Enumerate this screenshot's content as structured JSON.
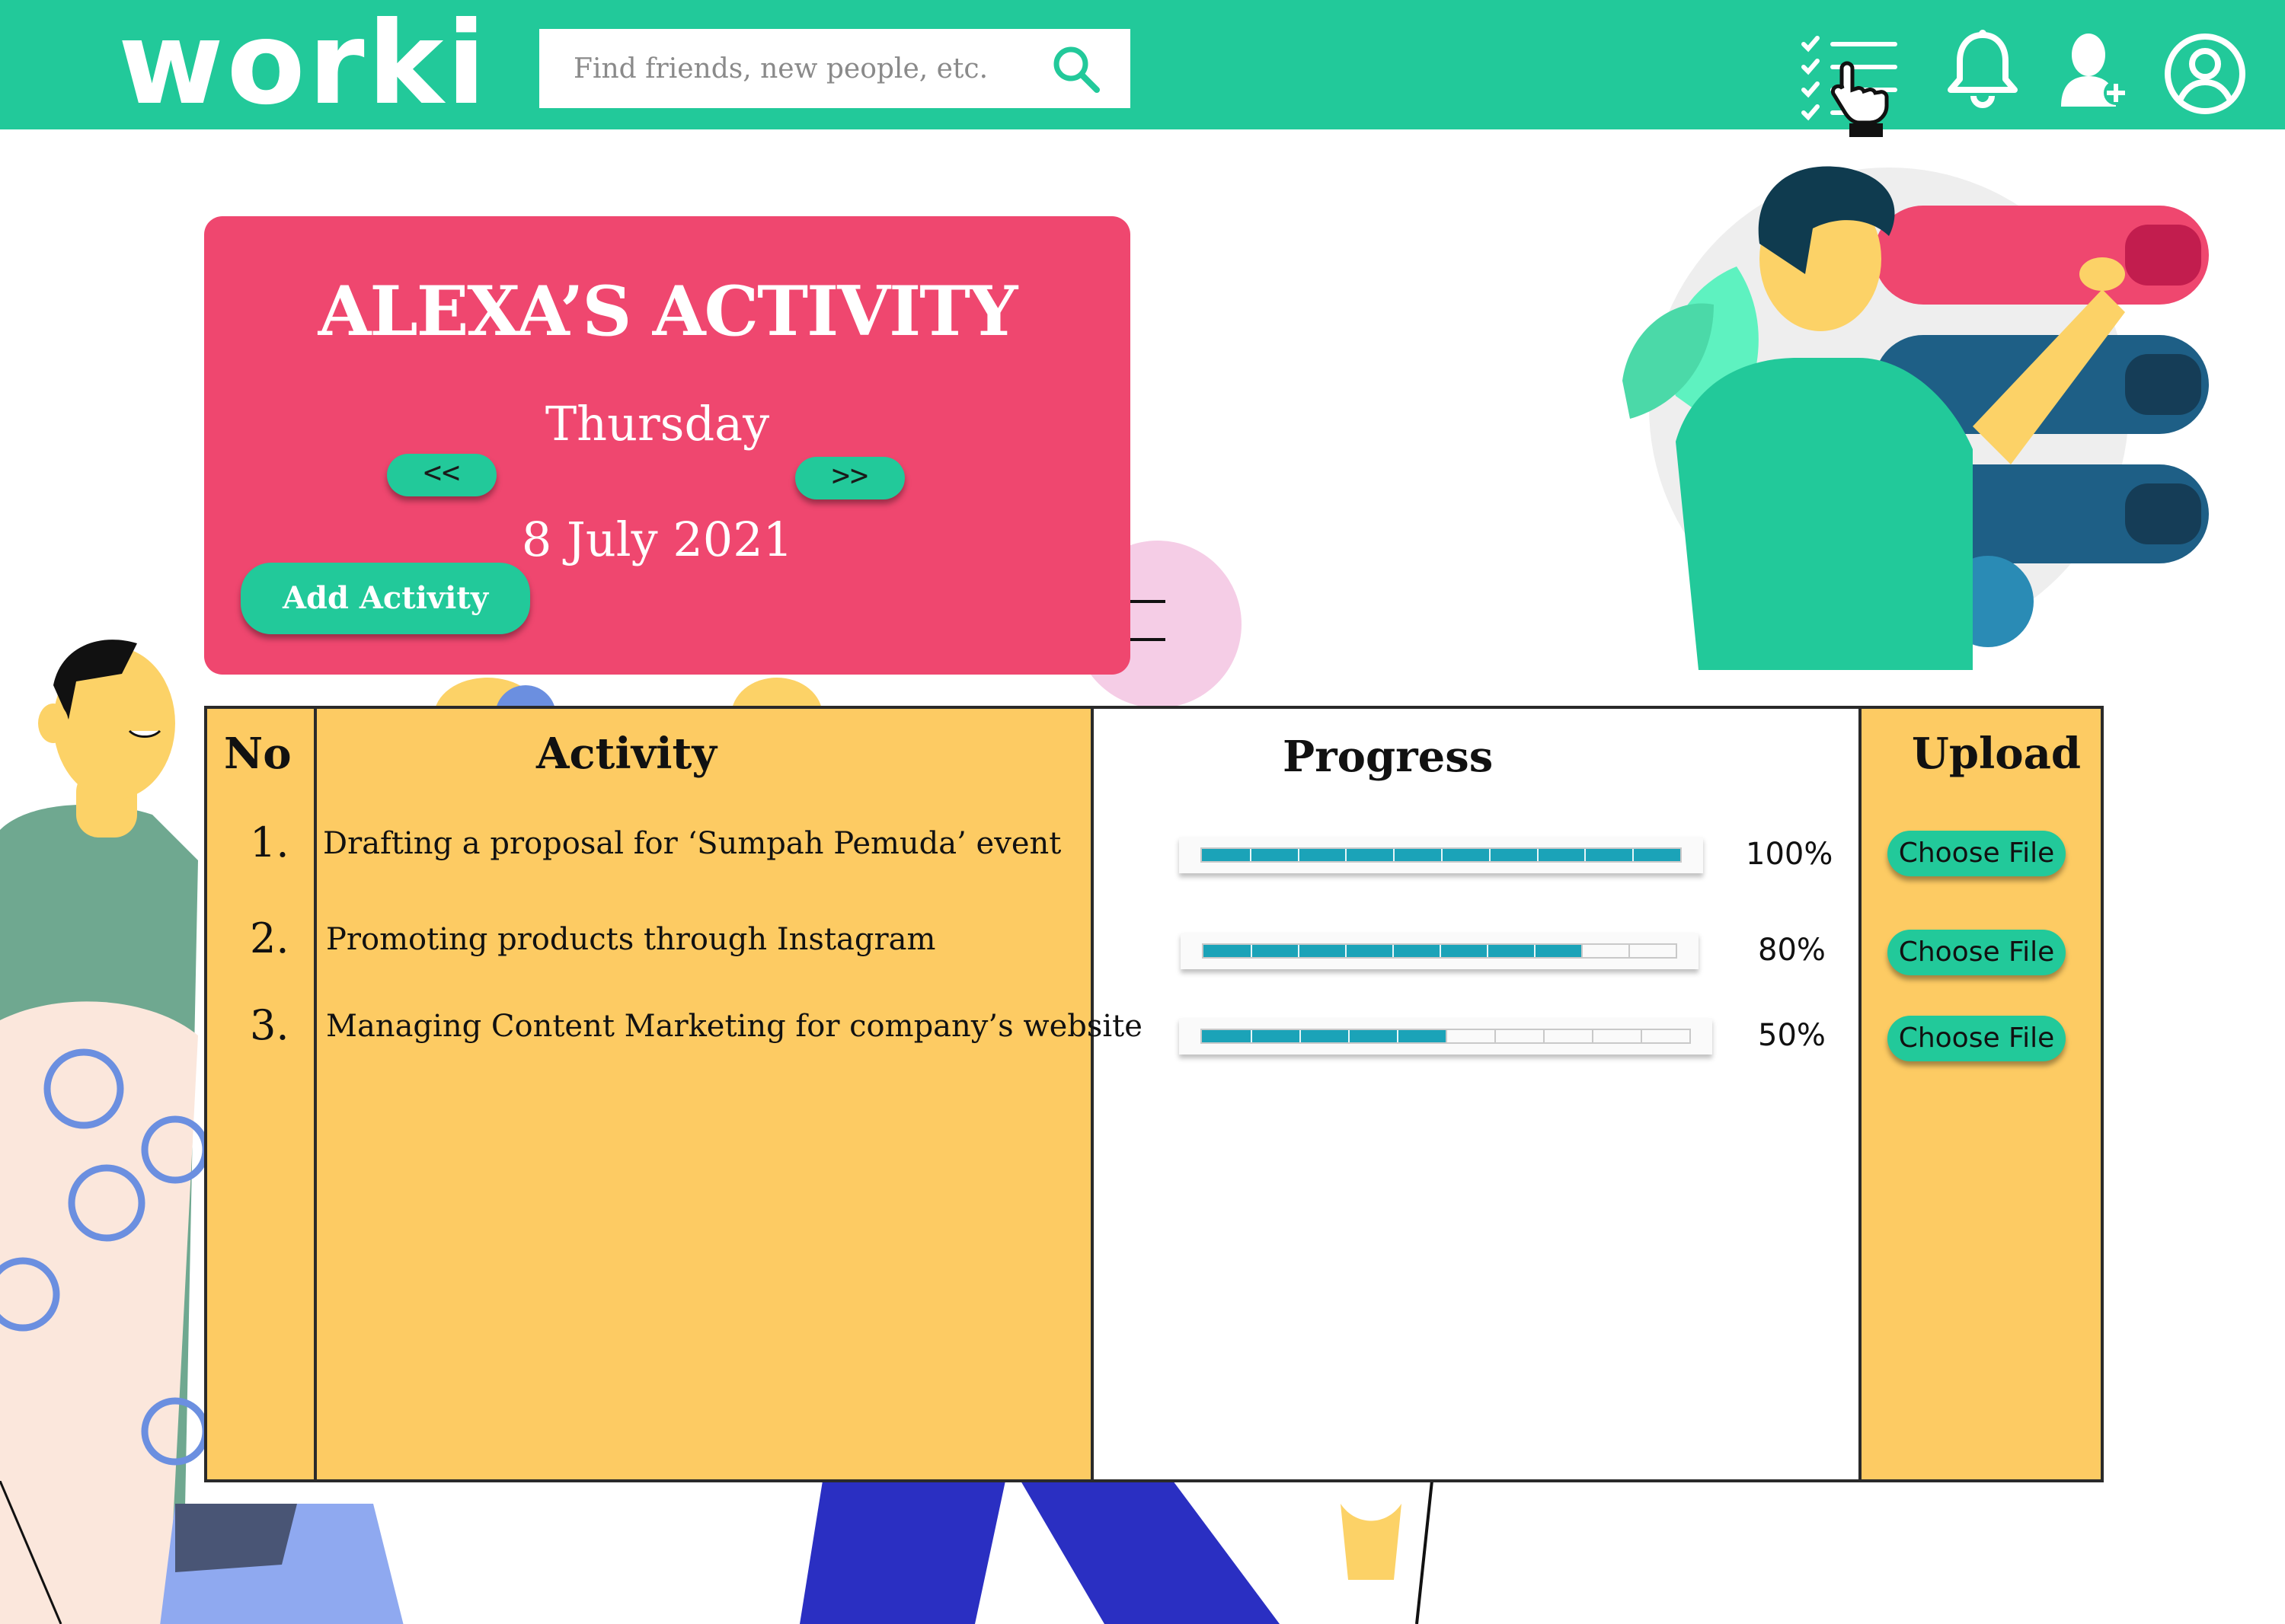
{
  "brand": {
    "logo_text": "worki"
  },
  "search": {
    "placeholder": "Find friends, new people, etc.",
    "value": ""
  },
  "nav_icons": [
    "checklist-icon",
    "bell-icon",
    "add-friend-icon",
    "profile-icon"
  ],
  "colors": {
    "topbar": "#22c99a",
    "card": "#ef476f",
    "table_yellow": "#fdcb63",
    "progress": "#1ba3b8"
  },
  "card": {
    "title": "ALEXA’S ACTIVITY",
    "day": "Thursday",
    "date": "8 July 2021",
    "prev_label": "<<",
    "next_label": ">>",
    "add_label": "Add Activity"
  },
  "table": {
    "headers": {
      "no": "No",
      "activity": "Activity",
      "progress": "Progress",
      "upload": "Upload"
    },
    "rows": [
      {
        "no": "1.",
        "activity": "Drafting a proposal for ‘Sumpah Pemuda’ event",
        "progress": 1.0,
        "progress_label": "100%",
        "upload_label": "Choose File"
      },
      {
        "no": "2.",
        "activity": "Promoting products through Instagram",
        "progress": 0.8,
        "progress_label": "80%",
        "upload_label": "Choose File"
      },
      {
        "no": "3.",
        "activity": "Managing Content Marketing for company’s website",
        "progress": 0.5,
        "progress_label": "50%",
        "upload_label": "Choose File"
      }
    ]
  }
}
